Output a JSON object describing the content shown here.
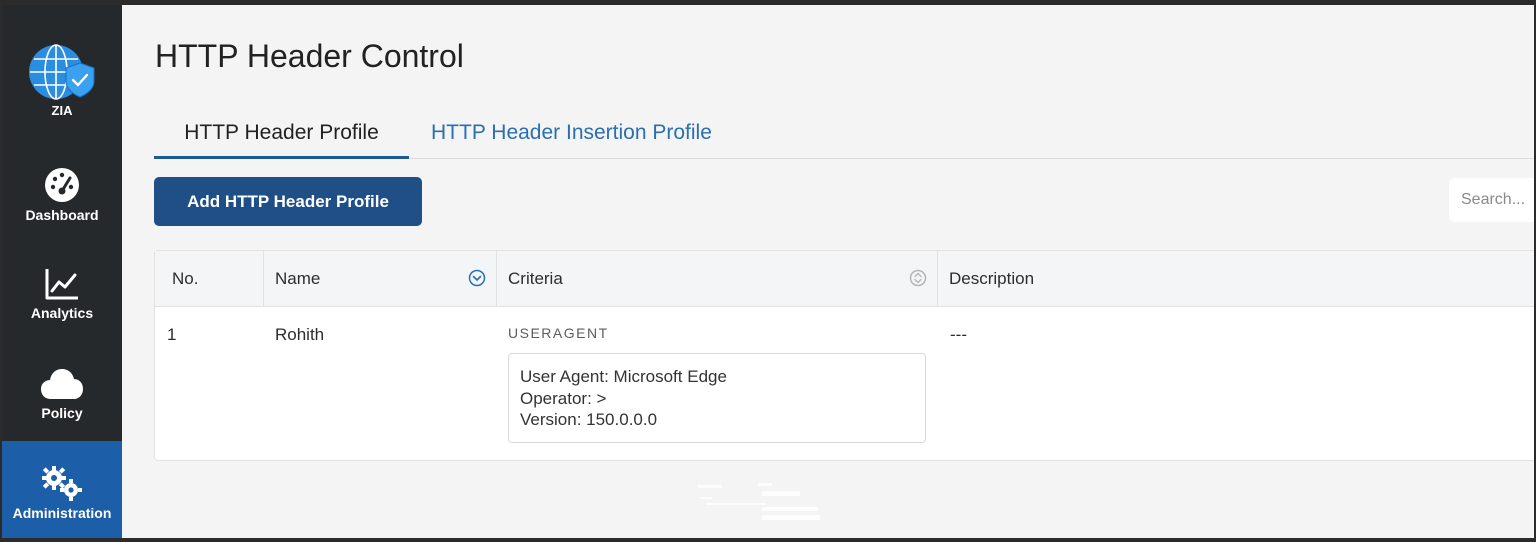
{
  "sidebar": {
    "items": [
      {
        "key": "zia",
        "label": "ZIA",
        "icon": "globe-shield-icon"
      },
      {
        "key": "dashboard",
        "label": "Dashboard",
        "icon": "gauge-icon"
      },
      {
        "key": "analytics",
        "label": "Analytics",
        "icon": "line-chart-icon"
      },
      {
        "key": "policy",
        "label": "Policy",
        "icon": "cloud-icon"
      },
      {
        "key": "administration",
        "label": "Administration",
        "icon": "gears-icon",
        "active": true
      }
    ]
  },
  "page": {
    "title": "HTTP Header Control"
  },
  "tabs": [
    {
      "label": "HTTP Header Profile",
      "active": true
    },
    {
      "label": "HTTP Header Insertion Profile",
      "active": false
    }
  ],
  "toolbar": {
    "add_label": "Add HTTP Header Profile",
    "search_placeholder": "Search..."
  },
  "table": {
    "columns": [
      "No.",
      "Name",
      "Criteria",
      "Description"
    ],
    "rows": [
      {
        "no": "1",
        "name": "Rohith",
        "criteria_type": "USERAGENT",
        "criteria_lines": [
          "User Agent: Microsoft Edge",
          "Operator: >",
          "Version: 150.0.0.0"
        ],
        "description": "---"
      }
    ]
  },
  "colors": {
    "sidebar_bg": "#26292c",
    "active_nav": "#1d5ea8",
    "primary_button": "#1f4f86",
    "tab_link": "#2a6fb0"
  }
}
